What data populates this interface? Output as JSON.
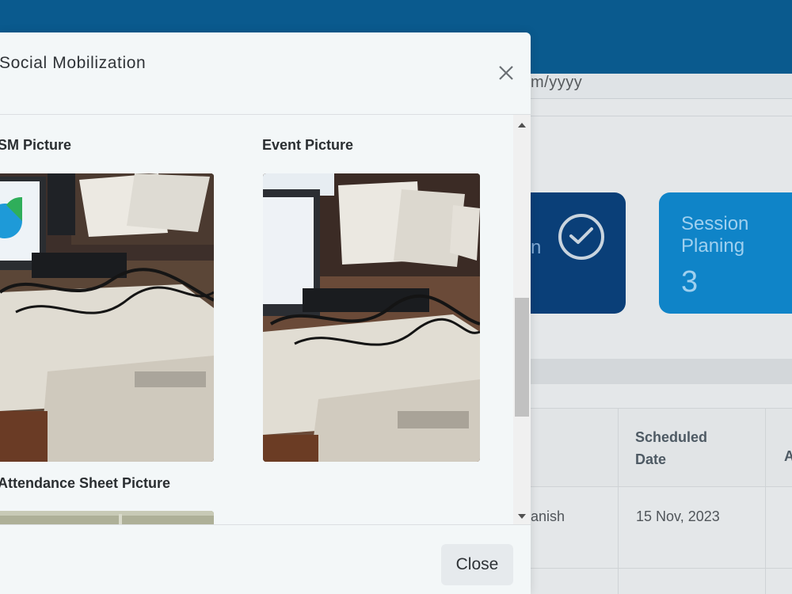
{
  "background": {
    "date_placeholder": "m/yyyy",
    "card_dark_fragment": "n",
    "card_blue": {
      "title": "Session Planing",
      "count": "3"
    },
    "table": {
      "header_scheduled": "Scheduled Date",
      "header_next": "A",
      "row_name": "anish",
      "row_date": "15 Nov, 2023"
    },
    "colors": {
      "topbar": "#0a5a8e",
      "card_dark": "#0a3f78",
      "card_blue": "#0f84c8"
    }
  },
  "modal": {
    "title": "Social Mobilization",
    "sections": {
      "sm_picture": "SM Picture",
      "event_picture": "Event Picture",
      "attendance_picture": "Attendance Sheet Picture"
    },
    "footer": {
      "close_label": "Close"
    }
  },
  "icons": {
    "close": "close-icon",
    "check": "check-circle-icon",
    "scroll_up": "triangle-up-icon",
    "scroll_down": "triangle-down-icon"
  }
}
